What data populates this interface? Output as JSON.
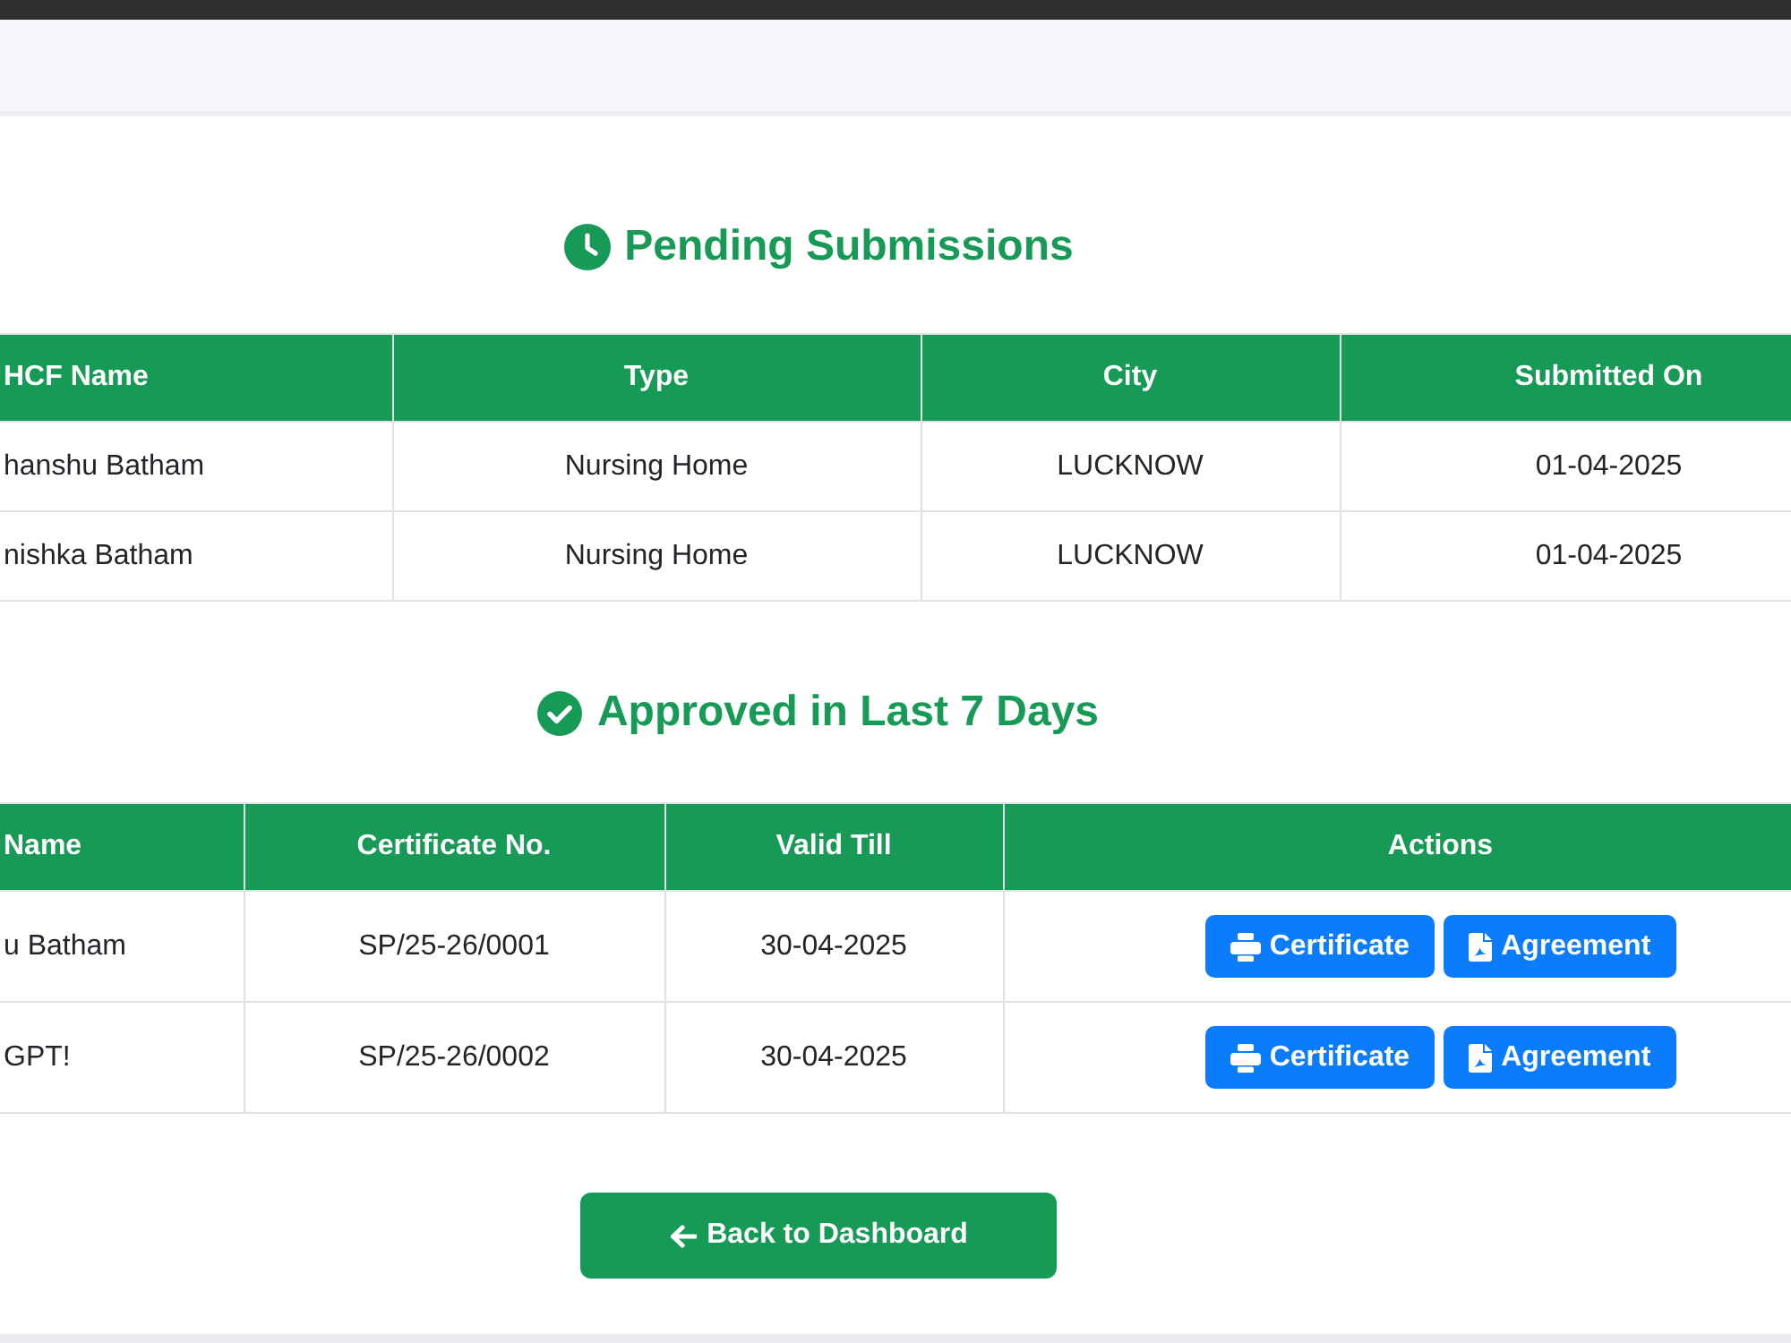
{
  "pending": {
    "title": "Pending Submissions",
    "columns": [
      "HCF Name",
      "Type",
      "City",
      "Submitted On"
    ],
    "rows": [
      [
        "hanshu Batham",
        "Nursing Home",
        "LUCKNOW",
        "01-04-2025"
      ],
      [
        "nishka Batham",
        "Nursing Home",
        "LUCKNOW",
        "01-04-2025"
      ]
    ]
  },
  "approved": {
    "title": "Approved in Last 7 Days",
    "columns": [
      "Name",
      "Certificate No.",
      "Valid Till",
      "Actions"
    ],
    "rows": [
      {
        "cells": [
          "u Batham",
          "SP/25-26/0001",
          "30-04-2025"
        ],
        "actions": [
          {
            "kind": "print",
            "label": "Certificate"
          },
          {
            "kind": "pdf",
            "label": "Agreement"
          }
        ]
      },
      {
        "cells": [
          "GPT!",
          "SP/25-26/0002",
          "30-04-2025"
        ],
        "actions": [
          {
            "kind": "print",
            "label": "Certificate"
          },
          {
            "kind": "pdf",
            "label": "Agreement"
          }
        ]
      }
    ]
  },
  "back_button": {
    "label": "Back to Dashboard"
  }
}
